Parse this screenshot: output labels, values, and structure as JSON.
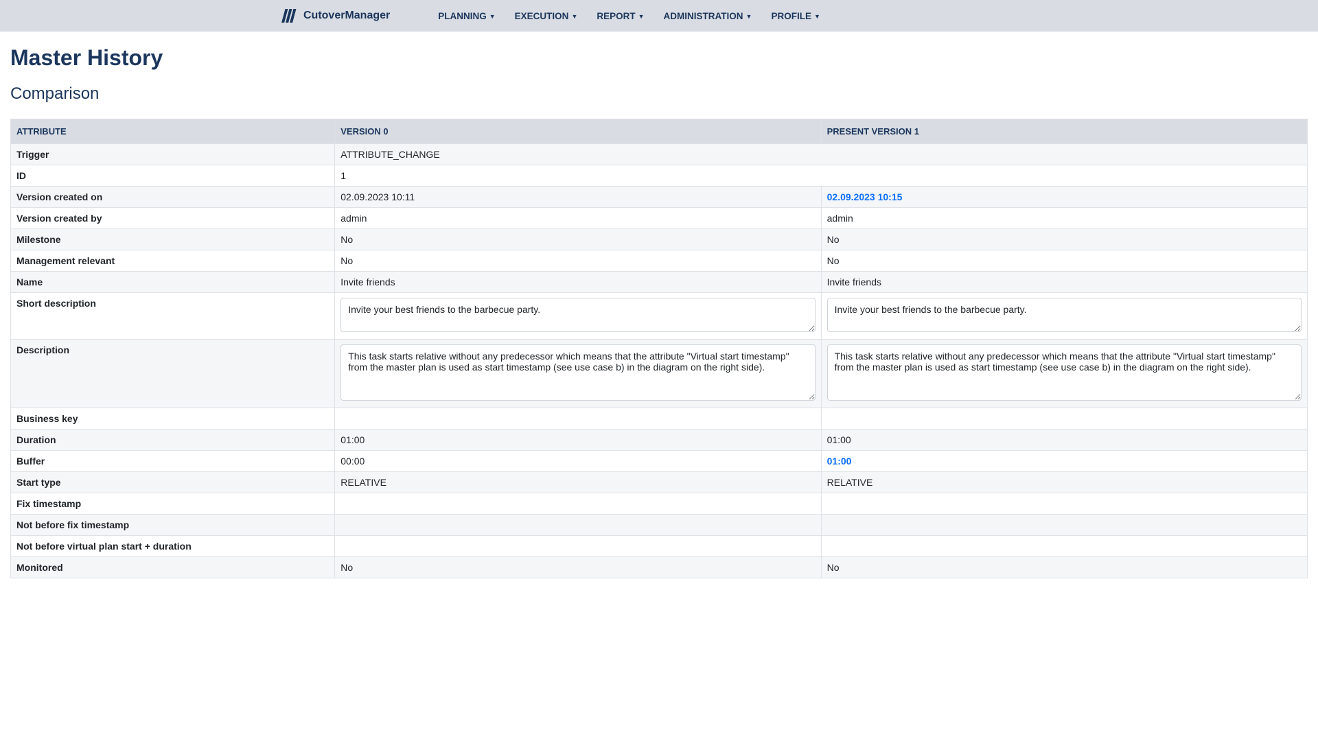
{
  "brand": "CutoverManager",
  "nav": [
    "PLANNING",
    "EXECUTION",
    "REPORT",
    "ADMINISTRATION",
    "PROFILE"
  ],
  "page_title": "Master History",
  "section_title": "Comparison",
  "headers": {
    "attribute": "ATTRIBUTE",
    "v0": "VERSION 0",
    "v1": "PRESENT VERSION 1"
  },
  "rows": [
    {
      "attr": "Trigger",
      "v0": "ATTRIBUTE_CHANGE",
      "v1": "",
      "span": true
    },
    {
      "attr": "ID",
      "v0": "1",
      "v1": "",
      "span": true
    },
    {
      "attr": "Version created on",
      "v0": "02.09.2023 10:11",
      "v1": "02.09.2023 10:15",
      "v1_changed": true
    },
    {
      "attr": "Version created by",
      "v0": "admin",
      "v1": "admin"
    },
    {
      "attr": "Milestone",
      "v0": "No",
      "v1": "No"
    },
    {
      "attr": "Management relevant",
      "v0": "No",
      "v1": "No"
    },
    {
      "attr": "Name",
      "v0": "Invite friends",
      "v1": "Invite friends"
    },
    {
      "attr": "Short description",
      "type": "textarea",
      "rows": 2,
      "v0": "Invite your best friends to the barbecue party.",
      "v1": "Invite your best friends to the barbecue party."
    },
    {
      "attr": "Description",
      "type": "textarea",
      "rows": 4,
      "v0": "This task starts relative without any predecessor which means that the attribute \"Virtual start timestamp\" from the master plan is used as start timestamp (see use case b) in the diagram on the right side).",
      "v1": "This task starts relative without any predecessor which means that the attribute \"Virtual start timestamp\" from the master plan is used as start timestamp (see use case b) in the diagram on the right side)."
    },
    {
      "attr": "Business key",
      "v0": "",
      "v1": ""
    },
    {
      "attr": "Duration",
      "v0": "01:00",
      "v1": "01:00"
    },
    {
      "attr": "Buffer",
      "v0": "00:00",
      "v1": "01:00",
      "v1_changed": true
    },
    {
      "attr": "Start type",
      "v0": "RELATIVE",
      "v1": "RELATIVE"
    },
    {
      "attr": "Fix timestamp",
      "v0": "",
      "v1": ""
    },
    {
      "attr": "Not before fix timestamp",
      "v0": "",
      "v1": ""
    },
    {
      "attr": "Not before virtual plan start + duration",
      "v0": "",
      "v1": ""
    },
    {
      "attr": "Monitored",
      "v0": "No",
      "v1": "No"
    }
  ]
}
